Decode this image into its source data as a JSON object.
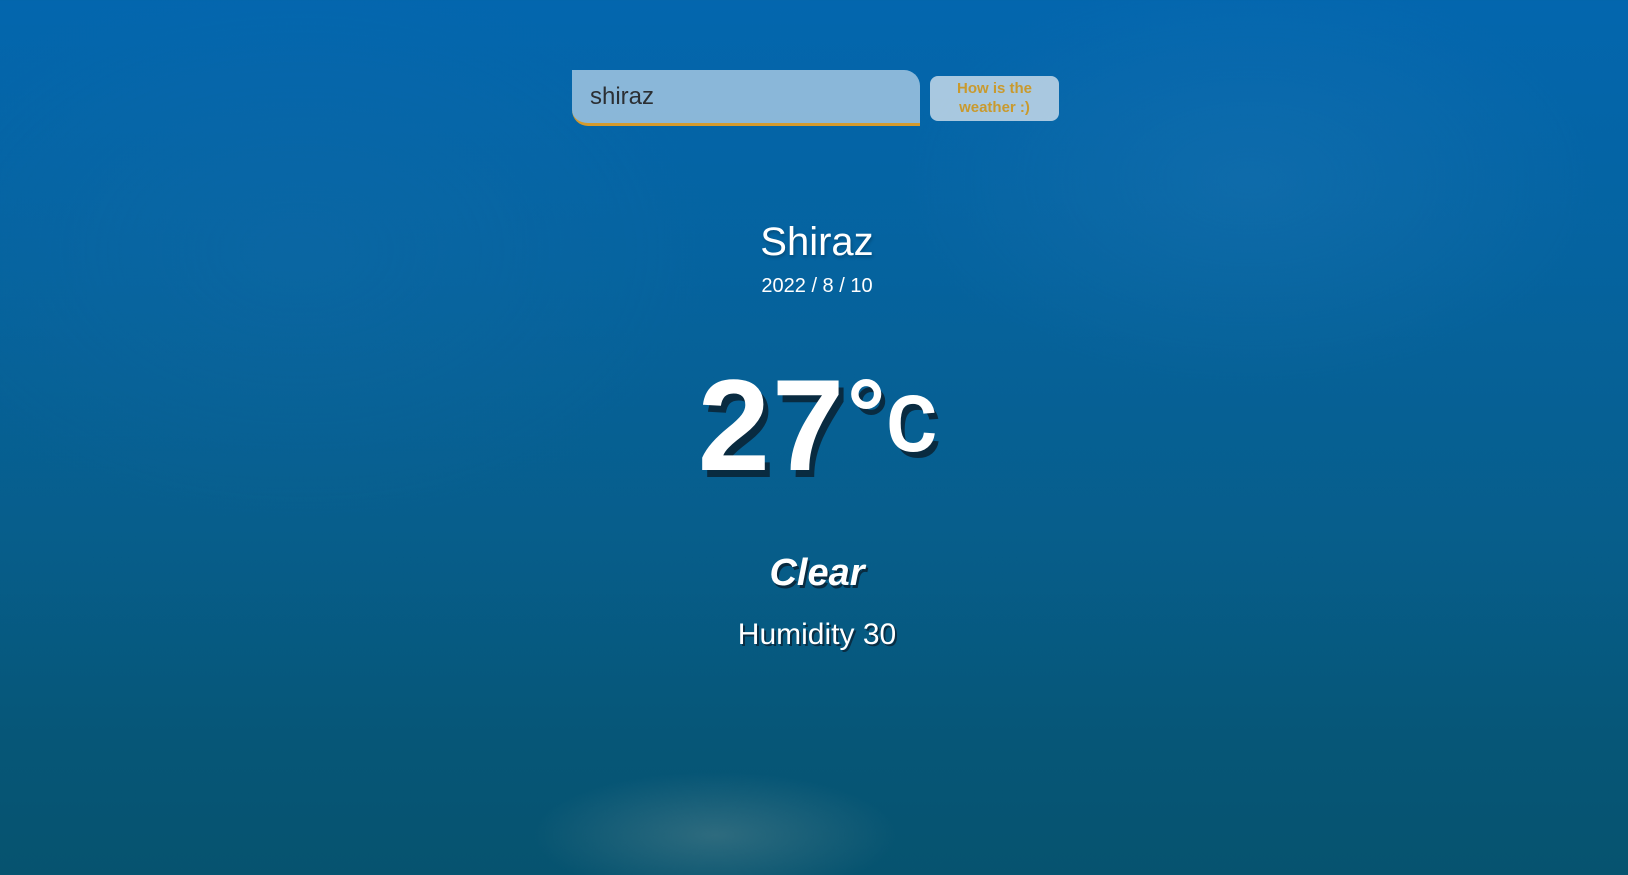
{
  "search": {
    "value": "shiraz",
    "button_label": "How is the weather :)"
  },
  "location": {
    "city": "Shiraz",
    "date": "2022 / 8 / 10"
  },
  "weather": {
    "temperature": "27",
    "unit": "°c",
    "condition": "Clear",
    "humidity_label": "Humidity 30"
  },
  "colors": {
    "accent": "#d59a2c",
    "button_text": "#c99a2e",
    "background_top": "#0366ae",
    "background_bottom": "#06536f"
  }
}
